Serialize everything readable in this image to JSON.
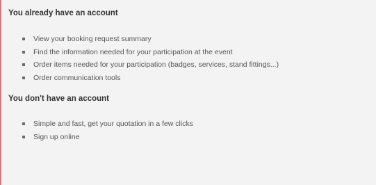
{
  "existing_account": {
    "title": "You already have an account",
    "items": [
      "View your booking request summary",
      "Find the information needed for your participation at the event",
      "Order items needed for your participation (badges, services, stand fittings...)",
      "Order communication tools"
    ]
  },
  "new_account": {
    "title": "You don't have an account",
    "items": [
      "Simple and fast, get your quotation in a few clicks",
      "Sign up online"
    ]
  },
  "colors": {
    "accent_border": "#e8736f",
    "panel_background": "#f3f3f3"
  }
}
